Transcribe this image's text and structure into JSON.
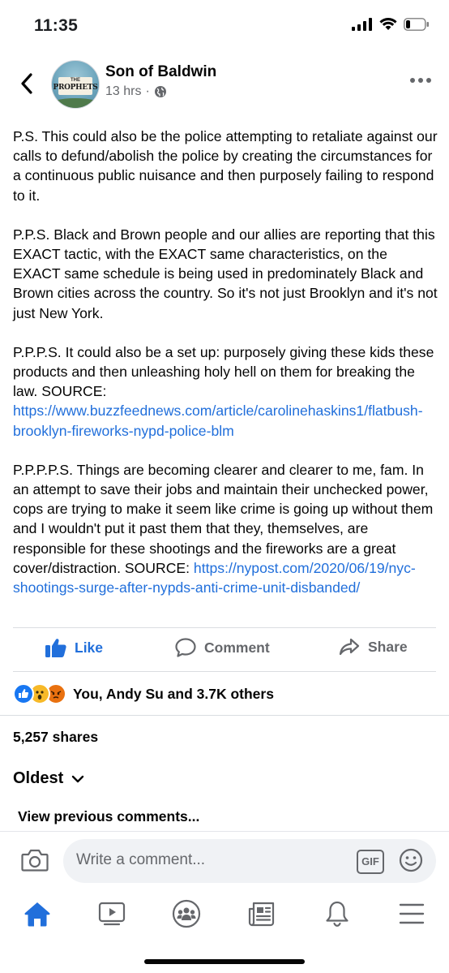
{
  "status_bar": {
    "time": "11:35"
  },
  "header": {
    "back_icon": "chevron-left-icon",
    "page_name": "Son of Baldwin",
    "time_ago": "13 hrs",
    "separator": "·",
    "privacy_icon": "globe-icon",
    "avatar_text": {
      "top": "THE",
      "main": "PROPHETS"
    }
  },
  "post": {
    "p1": "P.S. This could also be the police attempting to retaliate against our calls to defund/abolish the police by creating the circumstances for a continuous public nuisance and then purposely failing to respond to it.",
    "p2": "P.P.S. Black and Brown people and our allies are reporting that this EXACT tactic, with the EXACT same characteristics, on the EXACT same schedule is being used in predominately Black and Brown cities across the country. So it's not just Brooklyn and it's not just New York.",
    "p3_text": "P.P.P.S. It could also be a set up: purposely giving these kids these products and then unleashing holy hell on them for breaking the law. SOURCE: ",
    "p3_link": "https://www.buzzfeednews.com/article/carolinehaskins1/flatbush-brooklyn-fireworks-nypd-police-blm",
    "p4_text": "P.P.P.P.S. Things are becoming clearer and clearer to me, fam. In an attempt to save their jobs and maintain their unchecked power, cops are trying to make it seem like crime is going up without them and I wouldn't put it past them that they, themselves, are responsible for these shootings and the fireworks are a great cover/distraction. SOURCE: ",
    "p4_link": "https://nypost.com/2020/06/19/nyc-shootings-surge-after-nypds-anti-crime-unit-disbanded/"
  },
  "actions": {
    "like": "Like",
    "comment": "Comment",
    "share": "Share"
  },
  "reactions": {
    "icons": [
      "like",
      "wow",
      "angry"
    ],
    "text": "You, Andy Su and 3.7K others"
  },
  "shares": "5,257 shares",
  "sort": {
    "label": "Oldest"
  },
  "view_previous": "View previous comments...",
  "composer": {
    "placeholder": "Write a comment...",
    "gif_label": "GIF"
  },
  "tab_bar": {
    "icons": [
      "home-icon",
      "watch-icon",
      "groups-icon",
      "news-icon",
      "bell-icon",
      "menu-icon"
    ]
  },
  "colors": {
    "accent": "#216fdb",
    "text": "#050505",
    "secondary": "#65676b",
    "divider": "#dadde1"
  }
}
